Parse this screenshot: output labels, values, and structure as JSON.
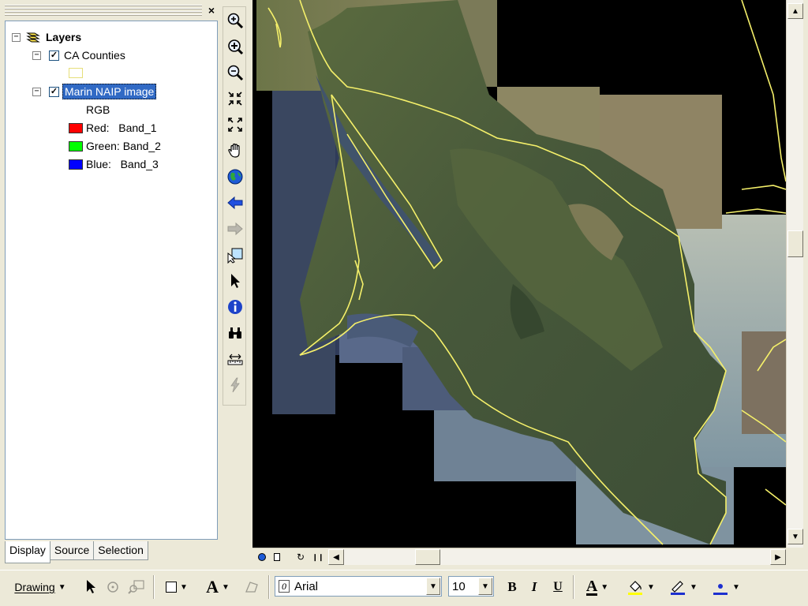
{
  "toc": {
    "close_label": "×",
    "root_label": "Layers",
    "layers": [
      {
        "label": "CA Counties",
        "checked": "✓"
      },
      {
        "label": "Marin NAIP image",
        "checked": "✓",
        "band_header": "RGB",
        "bands": [
          {
            "label": "Red:   Band_1",
            "color": "#ff0000"
          },
          {
            "label": "Green: Band_2",
            "color": "#00ff00"
          },
          {
            "label": "Blue:   Band_3",
            "color": "#0000ff"
          }
        ]
      }
    ],
    "tabs": [
      "Display",
      "Source",
      "Selection"
    ]
  },
  "tools": [
    "zoom-in",
    "fixed-zoom-in",
    "zoom-out",
    "fixed-zoom-in-center",
    "fixed-zoom-out-center",
    "pan",
    "full-extent",
    "back-extent",
    "forward-extent",
    "select-elements",
    "select-features",
    "identify",
    "find",
    "measure",
    "hyperlink"
  ],
  "map": {
    "background": "#000000",
    "boundary_color": "#f5f06a"
  },
  "drawbar": {
    "drawing_label": "Drawing",
    "font_name": "Arial",
    "font_size": "10",
    "bold": "B",
    "italic": "I",
    "underline": "U",
    "font_color_letter": "A",
    "text_tool_letter": "A"
  }
}
